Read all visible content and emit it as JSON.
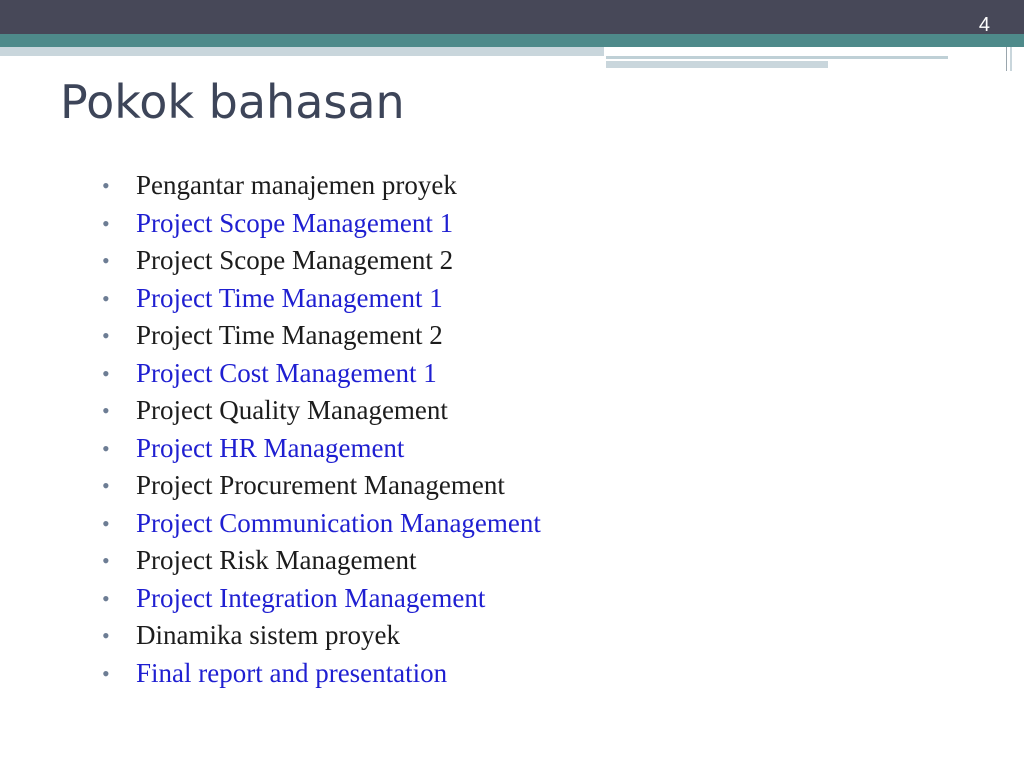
{
  "slide": {
    "page_number": "4",
    "title": "Pokok bahasan",
    "colors": {
      "header_dark": "#474858",
      "header_teal": "#4e8a8a",
      "title_text": "#3d4559",
      "bullet": "#6d7d94",
      "text_black": "#1c1c1c",
      "text_blue": "#1f1fd1"
    },
    "items": [
      {
        "text": "Pengantar manajemen proyek",
        "color": "black"
      },
      {
        "text": "Project Scope Management 1",
        "color": "blue"
      },
      {
        "text": "Project Scope Management 2",
        "color": "black"
      },
      {
        "text": "Project Time Management 1",
        "color": "blue"
      },
      {
        "text": "Project Time Management 2",
        "color": "black"
      },
      {
        "text": "Project Cost Management 1",
        "color": "blue"
      },
      {
        "text": "Project Quality Management",
        "color": "black"
      },
      {
        "text": "Project HR Management",
        "color": "blue"
      },
      {
        "text": "Project Procurement Management",
        "color": "black"
      },
      {
        "text": "Project Communication Management",
        "color": "blue"
      },
      {
        "text": "Project Risk Management",
        "color": "black"
      },
      {
        "text": "Project Integration Management",
        "color": "blue"
      },
      {
        "text": "Dinamika sistem proyek",
        "color": "black"
      },
      {
        "text": "Final report and presentation",
        "color": "blue"
      }
    ]
  }
}
